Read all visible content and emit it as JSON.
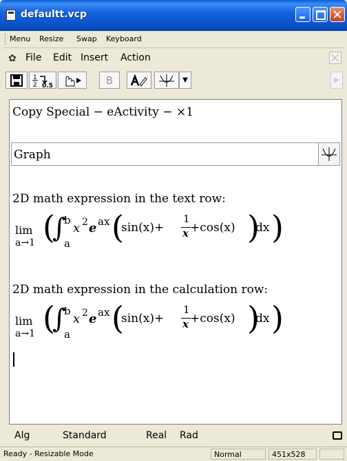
{
  "window": {
    "title": "defaultt.vcp"
  },
  "menubar1": {
    "items": [
      "Menu",
      "Resize",
      "Swap",
      "Keyboard"
    ]
  },
  "menubar2": {
    "items": [
      "File",
      "Edit",
      "Insert",
      "Action"
    ]
  },
  "toolbar": {
    "fraction_top": "1",
    "fraction_bottom": "2",
    "fraction_result": "0.5",
    "bold_label": "B"
  },
  "document": {
    "line1": "Copy Special − eActivity − ×1",
    "graph_label": "Graph",
    "text_row_heading": "2D math expression in the text row:",
    "calc_row_heading": "2D math expression in the calculation row:",
    "expression": {
      "lim": "lim",
      "limit_sub": "a→1",
      "upper": "b",
      "lower": "a",
      "integrand": "x",
      "exp1": "2",
      "e": "e",
      "exp2": "ax",
      "sin": "sin(x)+",
      "frac_num": "1",
      "frac_den": "x",
      "cos": "+cos(x)",
      "dx": "dx"
    }
  },
  "status": {
    "mode": "Alg",
    "format": "Standard",
    "number": "Real",
    "angle": "Rad"
  },
  "bottom": {
    "message": "Ready - Resizable Mode",
    "view": "Normal",
    "size": "451x528"
  }
}
